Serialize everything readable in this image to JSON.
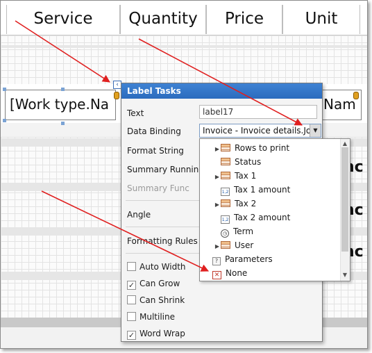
{
  "report": {
    "header_cells": [
      "Service",
      "Quantity",
      "Price",
      "Unit"
    ],
    "detail_field": "[Work type.Na",
    "right_field": "Nam",
    "right_fragments": [
      "nc",
      "nc",
      "nc"
    ]
  },
  "tasks_panel": {
    "title": "Label Tasks",
    "text_label": "Text",
    "text_value": "label17",
    "data_binding_label": "Data Binding",
    "data_binding_value": "Invoice - Invoice details.Jo",
    "format_string_label": "Format String",
    "summary_running_label": "Summary Running",
    "summary_func_label": "Summary Func",
    "angle_label": "Angle",
    "formatting_rules_label": "Formatting Rules",
    "checkboxes": [
      {
        "label": "Auto Width",
        "checked": false
      },
      {
        "label": "Can Grow",
        "checked": true
      },
      {
        "label": "Can Shrink",
        "checked": false
      },
      {
        "label": "Multiline",
        "checked": false
      },
      {
        "label": "Word Wrap",
        "checked": true
      }
    ]
  },
  "dropdown": {
    "items": [
      {
        "label": "Rows to print",
        "icon": "table-icon",
        "expandable": true
      },
      {
        "label": "Status",
        "icon": "table-icon",
        "expandable": false
      },
      {
        "label": "Tax 1",
        "icon": "table-icon",
        "expandable": true
      },
      {
        "label": "Tax 1 amount",
        "icon": "number-icon",
        "expandable": false
      },
      {
        "label": "Tax 2",
        "icon": "table-icon",
        "expandable": true
      },
      {
        "label": "Tax 2 amount",
        "icon": "number-icon",
        "expandable": false
      },
      {
        "label": "Term",
        "icon": "clock-icon",
        "expandable": false
      },
      {
        "label": "User",
        "icon": "table-icon",
        "expandable": true
      }
    ],
    "parameters_label": "Parameters",
    "none_label": "None"
  },
  "colors": {
    "panel_title": "#2b6bbe",
    "arrow": "#e02020"
  }
}
